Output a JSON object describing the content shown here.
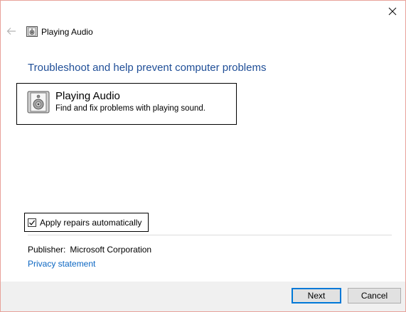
{
  "window": {
    "title": "Playing Audio",
    "close_icon": "close-icon",
    "back_icon": "back-arrow-icon"
  },
  "main": {
    "heading": "Troubleshoot and help prevent computer problems",
    "item": {
      "icon": "speaker-icon",
      "title": "Playing Audio",
      "description": "Find and fix problems with playing sound."
    },
    "apply_repairs": {
      "label": "Apply repairs automatically",
      "checked": true
    },
    "publisher": {
      "label": "Publisher:",
      "value": "Microsoft Corporation"
    },
    "privacy_link": "Privacy statement"
  },
  "footer": {
    "next_label": "Next",
    "cancel_label": "Cancel"
  },
  "colors": {
    "heading": "#1f4e97",
    "link": "#0b66c2",
    "primary_button_border": "#0078d7",
    "footer_background": "#f0f0f0"
  }
}
